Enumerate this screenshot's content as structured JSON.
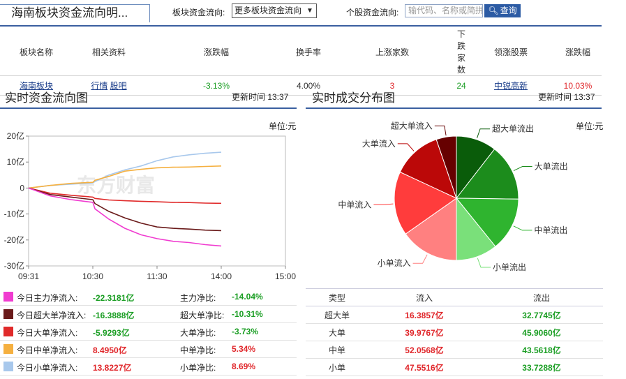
{
  "header": {
    "title": "海南板块资金流向明...",
    "sector_label": "板块资金流向:",
    "sector_select": "更多板块资金流向",
    "stock_label": "个股资金流向:",
    "stock_placeholder": "输代码、名称或简拼",
    "query_label": "查询"
  },
  "summary": {
    "headers": [
      "板块名称",
      "相关资料",
      "涨跌幅",
      "换手率",
      "上涨家数",
      "下跌家数",
      "领涨股票",
      "涨跌幅"
    ],
    "row": {
      "name": "海南板块",
      "link1": "行情",
      "link2": "股吧",
      "change": "-3.13%",
      "turnover": "4.00%",
      "up_count": "3",
      "down_count": "24",
      "leader": "中锐高新",
      "leader_change": "10.03%"
    }
  },
  "flow_section": {
    "title": "实时资金流向图",
    "update": "更新时间 13:37",
    "unit": "单位:元"
  },
  "volume_section": {
    "title": "实时成交分布图",
    "update": "更新时间 13:37",
    "unit": "单位:元"
  },
  "chart_data": [
    {
      "type": "line",
      "yunit": "亿",
      "ylim": [
        -30,
        20
      ],
      "yticks": [
        "20亿",
        "10亿",
        "0",
        "-10亿",
        "-20亿",
        "-30亿"
      ],
      "xticks": [
        "09:31",
        "10:30",
        "11:30",
        "14:00",
        "15:00"
      ],
      "grid": false,
      "series": [
        {
          "color": "#a8c8ec",
          "points": [
            [
              0,
              0
            ],
            [
              20,
              1.0
            ],
            [
              40,
              1.5
            ],
            [
              60,
              2.0
            ],
            [
              62,
              2.5
            ],
            [
              75,
              5.0
            ],
            [
              90,
              7.0
            ],
            [
              105,
              8.5
            ],
            [
              120,
              10.5
            ],
            [
              135,
              12.0
            ],
            [
              150,
              12.8
            ],
            [
              165,
              13.4
            ],
            [
              180,
              13.8
            ]
          ]
        },
        {
          "color": "#f5b040",
          "points": [
            [
              0,
              0
            ],
            [
              20,
              1.0
            ],
            [
              40,
              1.8
            ],
            [
              60,
              2.2
            ],
            [
              62,
              3.0
            ],
            [
              75,
              4.5
            ],
            [
              90,
              6.5
            ],
            [
              105,
              7.2
            ],
            [
              120,
              7.8
            ],
            [
              135,
              8.0
            ],
            [
              150,
              8.1
            ],
            [
              165,
              8.3
            ],
            [
              180,
              8.5
            ]
          ]
        },
        {
          "color": "#e02a2a",
          "points": [
            [
              0,
              0
            ],
            [
              20,
              -2.0
            ],
            [
              40,
              -2.8
            ],
            [
              60,
              -3.5
            ],
            [
              62,
              -4.0
            ],
            [
              75,
              -4.6
            ],
            [
              90,
              -4.9
            ],
            [
              105,
              -5.1
            ],
            [
              120,
              -5.3
            ],
            [
              135,
              -5.5
            ],
            [
              150,
              -5.6
            ],
            [
              165,
              -5.8
            ],
            [
              180,
              -5.9
            ]
          ]
        },
        {
          "color": "#6a1a1a",
          "points": [
            [
              0,
              0
            ],
            [
              20,
              -2.5
            ],
            [
              40,
              -3.5
            ],
            [
              60,
              -4.5
            ],
            [
              62,
              -6.0
            ],
            [
              75,
              -9.0
            ],
            [
              90,
              -11.5
            ],
            [
              105,
              -13.5
            ],
            [
              120,
              -15.0
            ],
            [
              135,
              -15.5
            ],
            [
              150,
              -15.8
            ],
            [
              165,
              -16.2
            ],
            [
              180,
              -16.4
            ]
          ]
        },
        {
          "color": "#f03cd0",
          "points": [
            [
              0,
              0
            ],
            [
              20,
              -3.0
            ],
            [
              40,
              -4.5
            ],
            [
              60,
              -5.5
            ],
            [
              62,
              -8.0
            ],
            [
              75,
              -12.0
            ],
            [
              90,
              -15.5
            ],
            [
              105,
              -18.0
            ],
            [
              120,
              -19.5
            ],
            [
              135,
              -20.5
            ],
            [
              150,
              -21.0
            ],
            [
              165,
              -21.8
            ],
            [
              180,
              -22.3
            ]
          ]
        }
      ]
    },
    {
      "type": "pie",
      "slices": [
        {
          "label": "超大单流出",
          "value": 32.7745,
          "color": "#0a5c0a"
        },
        {
          "label": "大单流出",
          "value": 45.906,
          "color": "#1c8c1c"
        },
        {
          "label": "中单流出",
          "value": 43.5618,
          "color": "#2fb42f"
        },
        {
          "label": "小单流出",
          "value": 33.7288,
          "color": "#7ae07a"
        },
        {
          "label": "小单流入",
          "value": 47.5516,
          "color": "#ff8080"
        },
        {
          "label": "中单流入",
          "value": 52.0568,
          "color": "#ff3c3c"
        },
        {
          "label": "大单流入",
          "value": 39.9767,
          "color": "#bb0808"
        },
        {
          "label": "超大单流入",
          "value": 16.3857,
          "color": "#660000"
        }
      ]
    }
  ],
  "legend": [
    {
      "color": "#f03cd0",
      "label": "今日主力净流入:",
      "value": "-22.3181亿",
      "value_color": "#1b9e24",
      "ratio_label": "主力净比:",
      "ratio": "-14.04%",
      "ratio_color": "#1b9e24"
    },
    {
      "color": "#6a1a1a",
      "label": "今日超大单净流入:",
      "value": "-16.3888亿",
      "value_color": "#1b9e24",
      "ratio_label": "超大单净比:",
      "ratio": "-10.31%",
      "ratio_color": "#1b9e24"
    },
    {
      "color": "#e02a2a",
      "label": "今日大单净流入:",
      "value": "-5.9293亿",
      "value_color": "#1b9e24",
      "ratio_label": "大单净比:",
      "ratio": "-3.73%",
      "ratio_color": "#1b9e24"
    },
    {
      "color": "#f5b040",
      "label": "今日中单净流入:",
      "value": "8.4950亿",
      "value_color": "#e0262a",
      "ratio_label": "中单净比:",
      "ratio": "5.34%",
      "ratio_color": "#e0262a"
    },
    {
      "color": "#a8c8ec",
      "label": "今日小单净流入:",
      "value": "13.8227亿",
      "value_color": "#e0262a",
      "ratio_label": "小单净比:",
      "ratio": "8.69%",
      "ratio_color": "#e0262a"
    }
  ],
  "volume_table": {
    "headers": [
      "类型",
      "流入",
      "流出"
    ],
    "rows": [
      {
        "type": "超大单",
        "in": "16.3857亿",
        "out": "32.7745亿"
      },
      {
        "type": "大单",
        "in": "39.9767亿",
        "out": "45.9060亿"
      },
      {
        "type": "中单",
        "in": "52.0568亿",
        "out": "43.5618亿"
      },
      {
        "type": "小单",
        "in": "47.5516亿",
        "out": "33.7288亿"
      }
    ]
  }
}
